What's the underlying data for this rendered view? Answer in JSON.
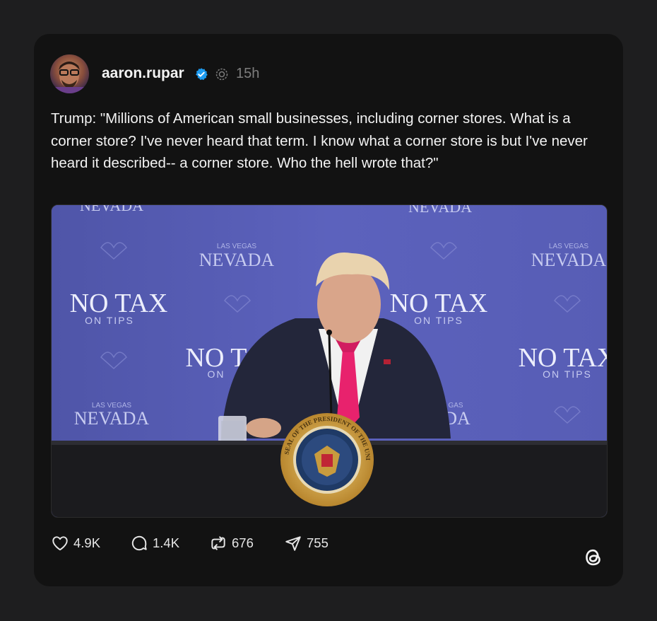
{
  "post": {
    "username": "aaron.rupar",
    "time": "15h",
    "text": "Trump: \"Millions of American small businesses, including corner stores. What is a corner store? I've never heard that term. I know what a corner store is but I've never heard it described-- a corner store. Who the hell wrote that?\"",
    "media": {
      "backdrop_top_left": "NEVADA",
      "backdrop_top_center": "NEVADA",
      "backdrop_small": "LAS VEGAS",
      "backdrop_nevada": "NEVADA",
      "backdrop_notax": "NO TAX",
      "backdrop_ontips": "ON TIPS",
      "backdrop_not": "NO T",
      "backdrop_on": "ON",
      "backdrop_das": "DA",
      "backdrop_gas": "GAS",
      "seal_top": "SEAL OF THE PRESIDENT OF THE UNITED STATES"
    }
  },
  "actions": {
    "likes": "4.9K",
    "replies": "1.4K",
    "reposts": "676",
    "shares": "755"
  },
  "icons": {
    "verified": "verified-badge-icon",
    "ai": "ai-info-icon",
    "like": "heart-icon",
    "reply": "comment-icon",
    "repost": "repost-icon",
    "share": "send-icon",
    "brand": "threads-logo-icon"
  },
  "colors": {
    "background": "#1e1e1f",
    "card": "#121212",
    "verified": "#1d9bf0",
    "tie": "#e8226d",
    "backdrop": "#5a5fb8"
  }
}
